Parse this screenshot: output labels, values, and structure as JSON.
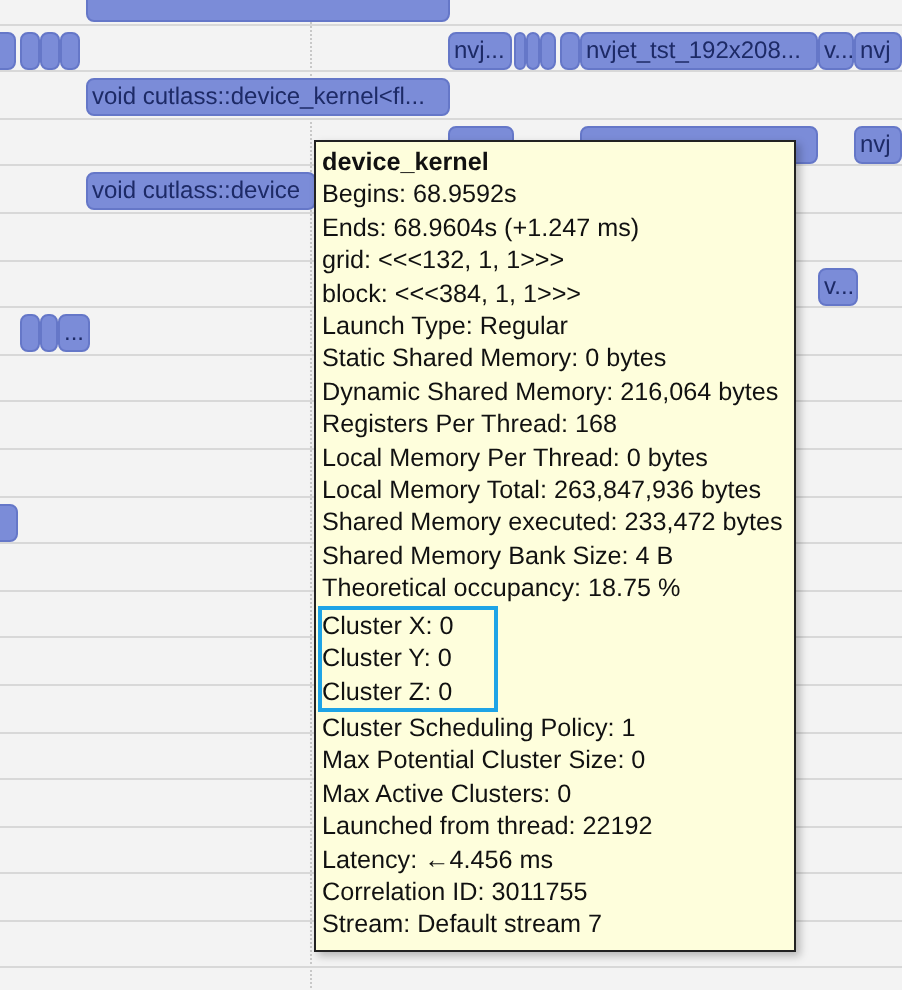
{
  "timeline": {
    "rows": [
      {
        "bars": [
          {
            "kind": "plain"
          }
        ]
      },
      {
        "bars": [
          {
            "kind": "plain"
          },
          {
            "kind": "plain"
          },
          {
            "kind": "plain"
          },
          {
            "kind": "plain"
          },
          {
            "kind": "labeled",
            "label": "nvj..."
          },
          {
            "kind": "plain"
          },
          {
            "kind": "plain"
          },
          {
            "kind": "plain"
          },
          {
            "kind": "plain"
          },
          {
            "kind": "labeled",
            "label": "nvjet_tst_192x208..."
          },
          {
            "kind": "labeled",
            "label": "v..."
          },
          {
            "kind": "labeled",
            "label": "nvj"
          }
        ]
      },
      {
        "bars": [
          {
            "kind": "labeled",
            "label": "void cutlass::device_kernel<fl..."
          }
        ]
      },
      {
        "bars": [
          {
            "kind": "plain"
          },
          {
            "kind": "plain"
          },
          {
            "kind": "labeled",
            "label": "nvj"
          }
        ]
      },
      {
        "bars": [
          {
            "kind": "labeled",
            "label": "void cutlass::device"
          }
        ]
      },
      {
        "bars": []
      },
      {
        "bars": [
          {
            "kind": "labeled",
            "label": "v..."
          }
        ]
      },
      {
        "bars": [
          {
            "kind": "plain"
          },
          {
            "kind": "plain"
          },
          {
            "kind": "labeled",
            "label": "..."
          }
        ]
      },
      {
        "bars": []
      },
      {
        "bars": []
      },
      {
        "bars": []
      },
      {
        "bars": [
          {
            "kind": "plain"
          }
        ]
      }
    ]
  },
  "tooltip": {
    "title": "device_kernel",
    "lines": [
      {
        "text": "Begins: 68.9592s",
        "highlighted": false
      },
      {
        "text": "Ends: 68.9604s (+1.247 ms)",
        "highlighted": false
      },
      {
        "text": "grid:  <<<132, 1, 1>>>",
        "highlighted": false
      },
      {
        "text": "block: <<<384, 1, 1>>>",
        "highlighted": false
      },
      {
        "text": "Launch Type: Regular",
        "highlighted": false
      },
      {
        "text": "Static Shared Memory: 0 bytes",
        "highlighted": false
      },
      {
        "text": "Dynamic Shared Memory: 216,064 bytes",
        "highlighted": false
      },
      {
        "text": "Registers Per Thread: 168",
        "highlighted": false
      },
      {
        "text": "Local Memory Per Thread: 0 bytes",
        "highlighted": false
      },
      {
        "text": "Local Memory Total: 263,847,936 bytes",
        "highlighted": false
      },
      {
        "text": "Shared Memory executed: 233,472 bytes",
        "highlighted": false
      },
      {
        "text": "Shared Memory Bank Size: 4 B",
        "highlighted": false
      },
      {
        "text": "Theoretical occupancy: 18.75 %",
        "highlighted": false
      },
      {
        "text": "Cluster X: 0",
        "highlighted": true
      },
      {
        "text": "Cluster Y: 0",
        "highlighted": true
      },
      {
        "text": "Cluster Z: 0",
        "highlighted": true
      },
      {
        "text": "Cluster Scheduling Policy: 1",
        "highlighted": false
      },
      {
        "text": "Max Potential Cluster Size: 0",
        "highlighted": false
      },
      {
        "text": "Max Active Clusters: 0",
        "highlighted": false
      },
      {
        "text": "Launched from thread: 22192",
        "highlighted": false
      },
      {
        "text": "Latency: ←4.456 ms",
        "highlighted": false
      },
      {
        "text": "Correlation ID: 3011755",
        "highlighted": false
      },
      {
        "text": "Stream: Default stream 7",
        "highlighted": false
      }
    ]
  }
}
